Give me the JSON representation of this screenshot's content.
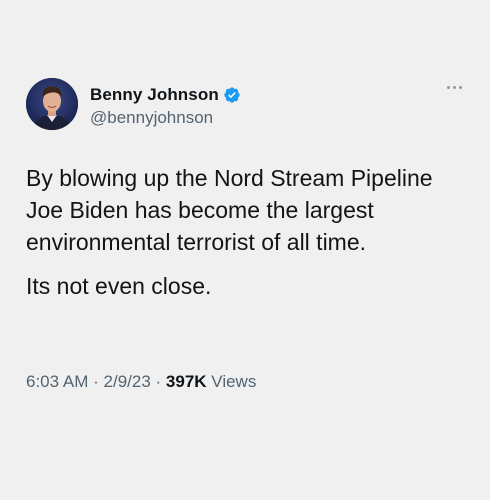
{
  "author": {
    "display_name": "Benny Johnson",
    "handle": "@bennyjohnson",
    "verified": true
  },
  "tweet": {
    "paragraphs": [
      "By blowing up the Nord Stream Pipeline Joe Biden has become the largest environmental terrorist of all time.",
      "Its not even close."
    ],
    "time": "6:03 AM",
    "separator": "·",
    "date": "2/9/23",
    "views_count": "397K",
    "views_label": "Views"
  },
  "icons": {
    "verified": "verified-badge-icon",
    "more": "more-options-icon"
  },
  "colors": {
    "background": "#f1f0f0",
    "verified_blue": "#1d9bf0",
    "secondary_text": "#536471",
    "primary_text": "#0f1419"
  }
}
